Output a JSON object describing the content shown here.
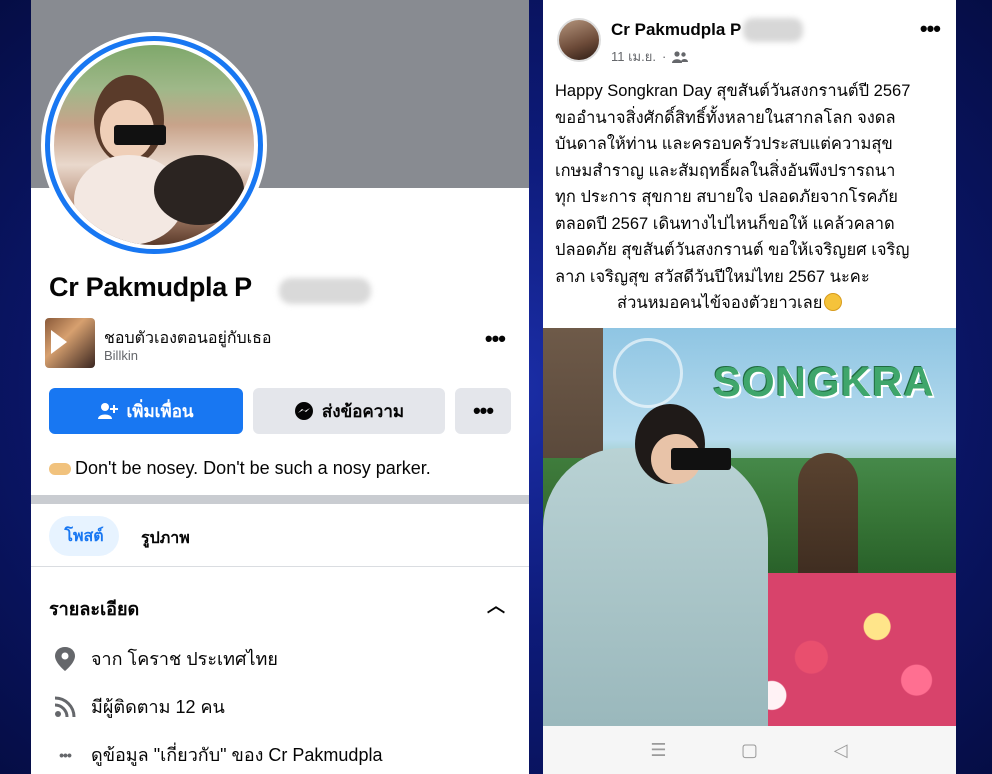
{
  "left_panel": {
    "profile_name": "Cr Pakmudpla P",
    "music": {
      "title": "ชอบตัวเองตอนอยู่กับเธอ",
      "artist": "Billkin"
    },
    "buttons": {
      "add_friend": "เพิ่มเพื่อน",
      "message": "ส่งข้อความ"
    },
    "bio": "Don't be nosey. Don't be such a nosy parker.",
    "tabs": [
      "โพสต์",
      "รูปภาพ"
    ],
    "details": {
      "title": "รายละเอียด",
      "rows": [
        {
          "icon": "location-pin-icon",
          "text": "จาก โคราช ประเทศไทย"
        },
        {
          "icon": "rss-followers-icon",
          "text": "มีผู้ติดตาม 12 คน"
        },
        {
          "icon": "more-dots-icon",
          "text": "ดูข้อมูล \"เกี่ยวกับ\" ของ Cr Pakmudpla"
        }
      ]
    }
  },
  "right_panel": {
    "post_author": "Cr Pakmudpla P",
    "post_date": "11 เม.ย.",
    "post_lines": [
      "Happy Songkran Day สุขสันต์วันสงกรานต์ปี 2567",
      "ขออำนาจสิ่งศักดิ์สิทธิ์ทั้งหลายในสากลโลก จงดล",
      "บันดาลให้ท่าน และครอบครัวประสบแต่ความสุข",
      "เกษมสำราญ และสัมฤทธิ์ผลในสิ่งอันพึงปรารถนา",
      "ทุก ประการ สุขกาย สบายใจ ปลอดภัยจากโรคภัย",
      "ตลอดปี 2567 เดินทางไปไหนก็ขอให้ แคล้วคลาด",
      "ปลอดภัย สุขสันต์วันสงกรานต์ ขอให้เจริญยศ เจริญ",
      "ลาภ เจริญสุข สวัสดีวันปีใหม่ไทย 2567 นะคะ"
    ],
    "post_last_line": "ส่วนหมอคนไข้จองตัวยาวเลย",
    "photo_sign": "SONGKRA",
    "nav": [
      "☰",
      "▢",
      "◁"
    ]
  },
  "colors": {
    "facebook_blue": "#1877f2",
    "background": "#0d1a78"
  }
}
